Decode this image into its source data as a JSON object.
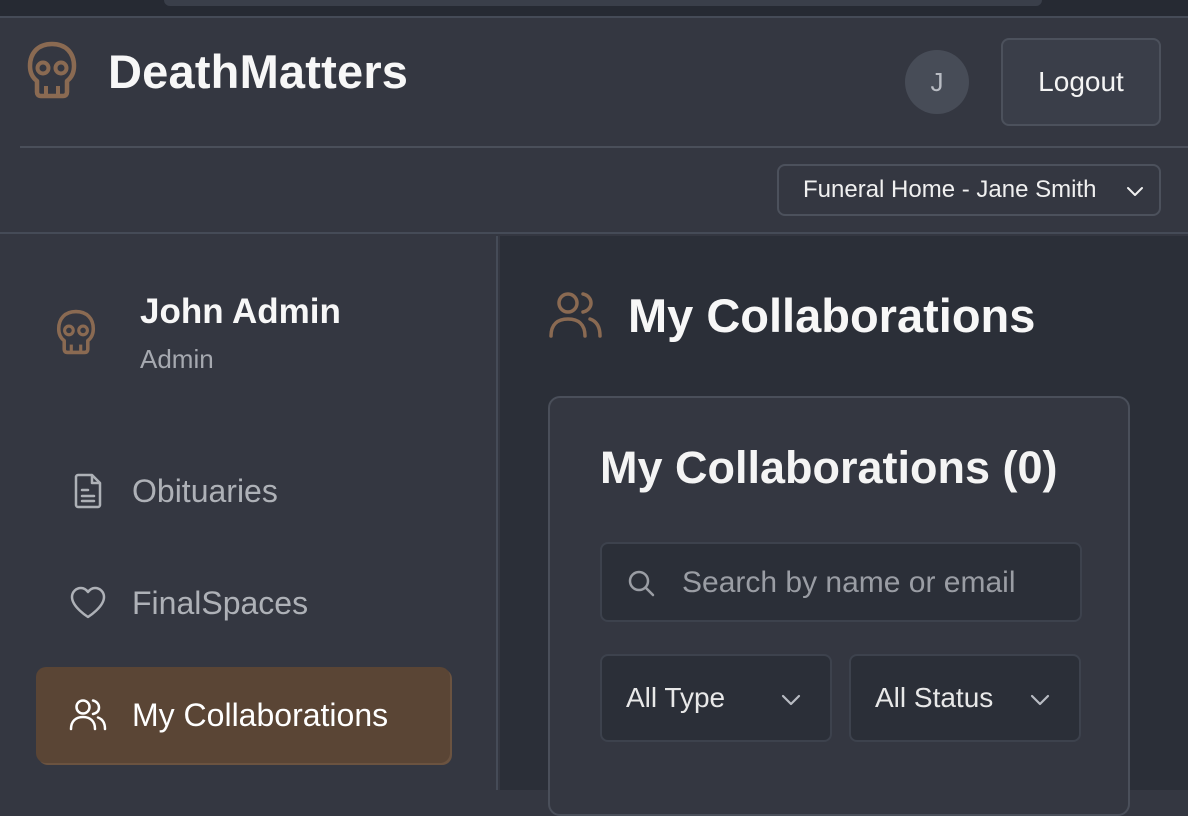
{
  "app": {
    "brand": "DeathMatters",
    "accent_color": "#8a6a52",
    "logo_icon": "skull-icon"
  },
  "header": {
    "avatar_initial": "J",
    "logout_label": "Logout",
    "org_select": {
      "selected": "Funeral Home - Jane Smith"
    }
  },
  "sidebar": {
    "user": {
      "name": "John Admin",
      "role": "Admin",
      "icon": "skull-icon"
    },
    "items": [
      {
        "label": "Obituaries",
        "icon": "document-icon",
        "active": false
      },
      {
        "label": "FinalSpaces",
        "icon": "heart-icon",
        "active": false
      },
      {
        "label": "My Collaborations",
        "icon": "users-icon",
        "active": true
      }
    ]
  },
  "main": {
    "title": "My Collaborations",
    "title_icon": "users-icon",
    "card": {
      "title": "My Collaborations (0)",
      "search_placeholder": "Search by name or email",
      "search_value": "",
      "filters": {
        "type": "All Type",
        "status": "All Status"
      }
    }
  }
}
